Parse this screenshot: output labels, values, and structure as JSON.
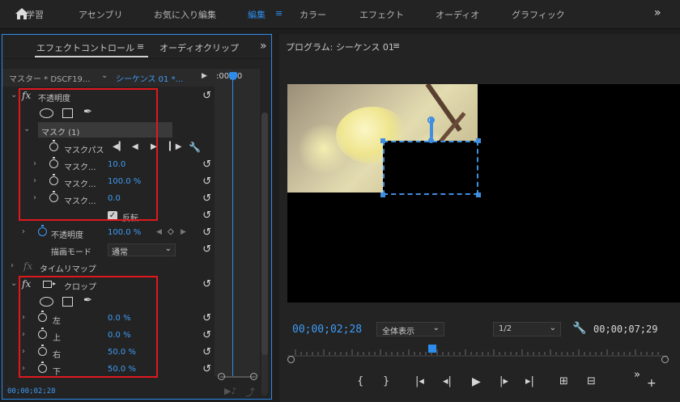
{
  "workspace_tabs": [
    "学習",
    "アセンブリ",
    "お気に入り編集",
    "編集",
    "カラー",
    "エフェクト",
    "オーディオ",
    "グラフィック"
  ],
  "workspace_active": "編集",
  "effect_controls": {
    "tab_effect": "エフェクトコントロール",
    "tab_audio": "オーディオクリップミ",
    "master_clip": "マスター * DSCF19...",
    "sequence": "シーケンス 01 *...",
    "time_ruler": ":00;00",
    "timecode_bottom": "00;00;02;28",
    "opacity": {
      "name": "不透明度",
      "mask_name": "マスク (1)",
      "mask_path": "マスクパス",
      "mask_rows": [
        {
          "label": "マスク...",
          "value": "10.0"
        },
        {
          "label": "マスク...",
          "value": "100.0 %"
        },
        {
          "label": "マスク...",
          "value": "0.0"
        }
      ],
      "invert": "反転",
      "opacity_label": "不透明度",
      "opacity_value": "100.0 %",
      "blend_label": "描画モード",
      "blend_value": "通常"
    },
    "time_remap": "タイムリマップ",
    "crop": {
      "name": "クロップ",
      "rows": [
        {
          "label": "左",
          "value": "0.0 %"
        },
        {
          "label": "上",
          "value": "0.0 %"
        },
        {
          "label": "右",
          "value": "50.0 %"
        },
        {
          "label": "下",
          "value": "50.0 %"
        }
      ]
    }
  },
  "program": {
    "title": "プログラム: シーケンス 01",
    "timecode_current": "00;00;02;28",
    "zoom": "全体表示",
    "resolution": "1/2",
    "timecode_duration": "00;00;07;29",
    "playhead_fraction": 0.38
  },
  "colors": {
    "accent": "#2d8ceb",
    "highlight_box": "#e0181e",
    "value_blue": "#3f9cf5"
  }
}
